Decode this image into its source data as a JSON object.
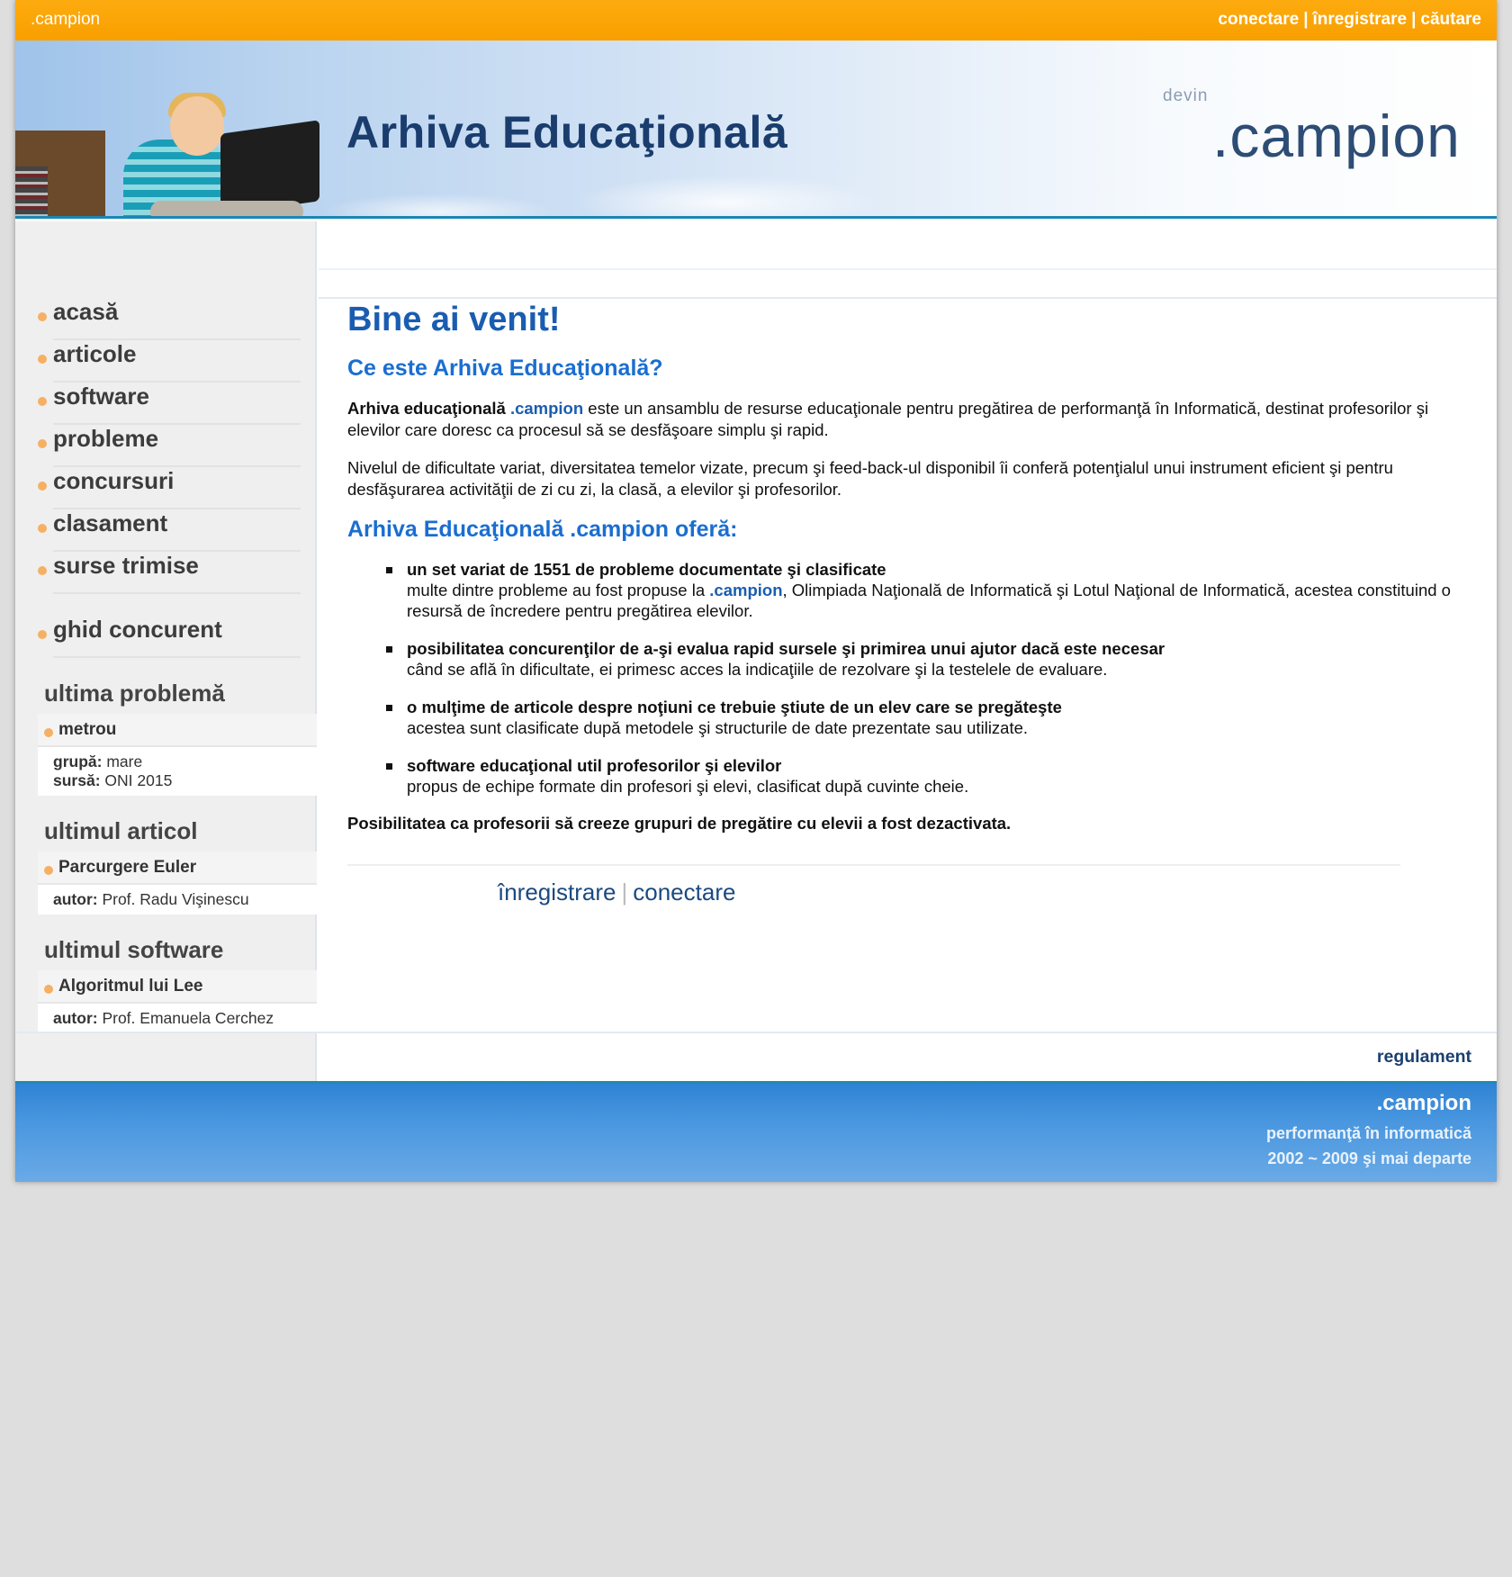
{
  "topbar": {
    "brand": ".campion",
    "links": [
      "conectare",
      "înregistrare",
      "căutare"
    ]
  },
  "banner": {
    "title": "Arhiva Educaţională",
    "devin": "devin",
    "logo": ".campion"
  },
  "menu": [
    "acasă",
    "articole",
    "software",
    "probleme",
    "concursuri",
    "clasament",
    "surse trimise"
  ],
  "menu_extra": "ghid concurent",
  "latest_problem": {
    "title": "ultima problemă",
    "name": "metrou",
    "group_label": "grupă:",
    "group": "mare",
    "source_label": "sursă:",
    "source": "ONI 2015"
  },
  "latest_article": {
    "title": "ultimul articol",
    "name": "Parcurgere Euler",
    "author_label": "autor:",
    "author": "Prof. Radu Vişinescu"
  },
  "latest_software": {
    "title": "ultimul software",
    "name": "Algoritmul lui Lee",
    "author_label": "autor:",
    "author": "Prof. Emanuela Cerchez"
  },
  "main": {
    "heading": "Bine ai venit!",
    "subheading1": "Ce este Arhiva Educaţională?",
    "p1_bold": "Arhiva educaţională",
    "p1_brand": ".campion",
    "p1_rest": " este un ansamblu de resurse educaţionale pentru pregătirea de performanţă în Informatică, destinat profesorilor şi elevilor care doresc ca procesul să se desfăşoare simplu şi rapid.",
    "p2": "Nivelul de dificultate variat, diversitatea temelor vizate, precum şi feed-back-ul disponibil îi conferă potenţialul unui instrument eficient şi pentru desfăşurarea activităţii de zi cu zi, la clasă, a elevilor şi profesorilor.",
    "subheading2": "Arhiva Educaţională .campion oferă:",
    "offers": [
      {
        "head": "un set variat de 1551 de probleme documentate şi clasificate",
        "body_pre": "multe dintre probleme au fost propuse la ",
        "body_brand": ".campion",
        "body_post": ", Olimpiada Naţională de Informatică şi Lotul Naţional de Informatică, acestea constituind o resursă de încredere pentru pregătirea elevilor."
      },
      {
        "head": "posibilitatea concurenţilor de a-şi evalua rapid sursele şi primirea unui ajutor dacă este necesar",
        "body": "când se află în dificultate, ei primesc acces la indicaţiile de rezolvare şi la testelele de evaluare."
      },
      {
        "head": "o mulţime de articole despre noţiuni ce trebuie ştiute de un elev care se pregăteşte",
        "body": "acestea sunt clasificate după metodele şi structurile de date prezentate sau utilizate."
      },
      {
        "head": "software educaţional util profesorilor şi elevilor",
        "body": "propus de echipe formate din profesori şi elevi, clasificat după cuvinte cheie."
      }
    ],
    "final": "Posibilitatea ca profesorii să creeze grupuri de pregătire cu elevii a fost dezactivata.",
    "register_link": "înregistrare",
    "login_link": "conectare"
  },
  "footer": {
    "regulament": "regulament",
    "brand": ".campion",
    "tagline": "performanţă în informatică",
    "years": "2002 ~ 2009 şi mai departe"
  }
}
